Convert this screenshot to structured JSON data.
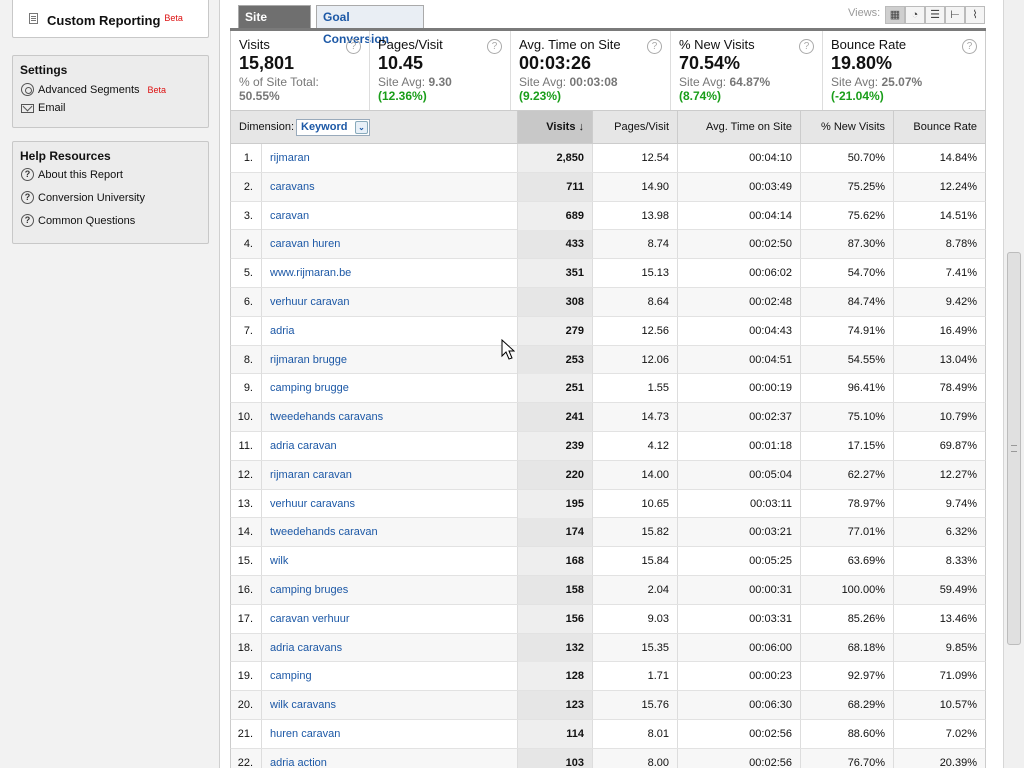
{
  "sidebar": {
    "custom_reporting": {
      "label": "Custom Reporting",
      "badge": "Beta"
    },
    "settings": {
      "title": "Settings",
      "items": [
        {
          "label": "Advanced Segments",
          "badge": "Beta",
          "icon": "segments-icon"
        },
        {
          "label": "Email",
          "icon": "email-icon"
        }
      ]
    },
    "help": {
      "title": "Help Resources",
      "items": [
        {
          "label": "About this Report"
        },
        {
          "label": "Conversion University"
        },
        {
          "label": "Common Questions"
        }
      ]
    }
  },
  "tabs": [
    {
      "label": "Site Usage",
      "active": true
    },
    {
      "label": "Goal Conversion",
      "active": false
    }
  ],
  "views": {
    "label": "Views:"
  },
  "summary": [
    {
      "name": "Visits",
      "value": "15,801",
      "sub_label": "% of Site Total:",
      "sub_value": "50.55%"
    },
    {
      "name": "Pages/Visit",
      "value": "10.45",
      "sub_label": "Site Avg:",
      "sub_value": "9.30",
      "pct": "(12.36%)"
    },
    {
      "name": "Avg. Time on Site",
      "value": "00:03:26",
      "sub_label": "Site Avg:",
      "sub_value": "00:03:08",
      "pct": "(9.23%)"
    },
    {
      "name": "% New Visits",
      "value": "70.54%",
      "sub_label": "Site Avg:",
      "sub_value": "64.87%",
      "pct": "(8.74%)"
    },
    {
      "name": "Bounce Rate",
      "value": "19.80%",
      "sub_label": "Site Avg:",
      "sub_value": "25.07%",
      "pct": "(-21.04%)"
    }
  ],
  "table": {
    "dimension_label": "Dimension:",
    "dimension_value": "Keyword",
    "headers": {
      "visits": "Visits",
      "pages": "Pages/Visit",
      "time": "Avg. Time on Site",
      "new": "% New Visits",
      "bounce": "Bounce Rate"
    },
    "rows": [
      [
        "1.",
        "rijmaran",
        "2,850",
        "12.54",
        "00:04:10",
        "50.70%",
        "14.84%"
      ],
      [
        "2.",
        "caravans",
        "711",
        "14.90",
        "00:03:49",
        "75.25%",
        "12.24%"
      ],
      [
        "3.",
        "caravan",
        "689",
        "13.98",
        "00:04:14",
        "75.62%",
        "14.51%"
      ],
      [
        "4.",
        "caravan huren",
        "433",
        "8.74",
        "00:02:50",
        "87.30%",
        "8.78%"
      ],
      [
        "5.",
        "www.rijmaran.be",
        "351",
        "15.13",
        "00:06:02",
        "54.70%",
        "7.41%"
      ],
      [
        "6.",
        "verhuur caravan",
        "308",
        "8.64",
        "00:02:48",
        "84.74%",
        "9.42%"
      ],
      [
        "7.",
        "adria",
        "279",
        "12.56",
        "00:04:43",
        "74.91%",
        "16.49%"
      ],
      [
        "8.",
        "rijmaran brugge",
        "253",
        "12.06",
        "00:04:51",
        "54.55%",
        "13.04%"
      ],
      [
        "9.",
        "camping brugge",
        "251",
        "1.55",
        "00:00:19",
        "96.41%",
        "78.49%"
      ],
      [
        "10.",
        "tweedehands caravans",
        "241",
        "14.73",
        "00:02:37",
        "75.10%",
        "10.79%"
      ],
      [
        "11.",
        "adria caravan",
        "239",
        "4.12",
        "00:01:18",
        "17.15%",
        "69.87%"
      ],
      [
        "12.",
        "rijmaran caravan",
        "220",
        "14.00",
        "00:05:04",
        "62.27%",
        "12.27%"
      ],
      [
        "13.",
        "verhuur caravans",
        "195",
        "10.65",
        "00:03:11",
        "78.97%",
        "9.74%"
      ],
      [
        "14.",
        "tweedehands caravan",
        "174",
        "15.82",
        "00:03:21",
        "77.01%",
        "6.32%"
      ],
      [
        "15.",
        "wilk",
        "168",
        "15.84",
        "00:05:25",
        "63.69%",
        "8.33%"
      ],
      [
        "16.",
        "camping bruges",
        "158",
        "2.04",
        "00:00:31",
        "100.00%",
        "59.49%"
      ],
      [
        "17.",
        "caravan verhuur",
        "156",
        "9.03",
        "00:03:31",
        "85.26%",
        "13.46%"
      ],
      [
        "18.",
        "adria caravans",
        "132",
        "15.35",
        "00:06:00",
        "68.18%",
        "9.85%"
      ],
      [
        "19.",
        "camping",
        "128",
        "1.71",
        "00:00:23",
        "92.97%",
        "71.09%"
      ],
      [
        "20.",
        "wilk caravans",
        "123",
        "15.76",
        "00:06:30",
        "68.29%",
        "10.57%"
      ],
      [
        "21.",
        "huren caravan",
        "114",
        "8.01",
        "00:02:56",
        "88.60%",
        "7.02%"
      ],
      [
        "22.",
        "adria action",
        "103",
        "8.00",
        "00:02:56",
        "76.70%",
        "20.39%"
      ]
    ]
  }
}
